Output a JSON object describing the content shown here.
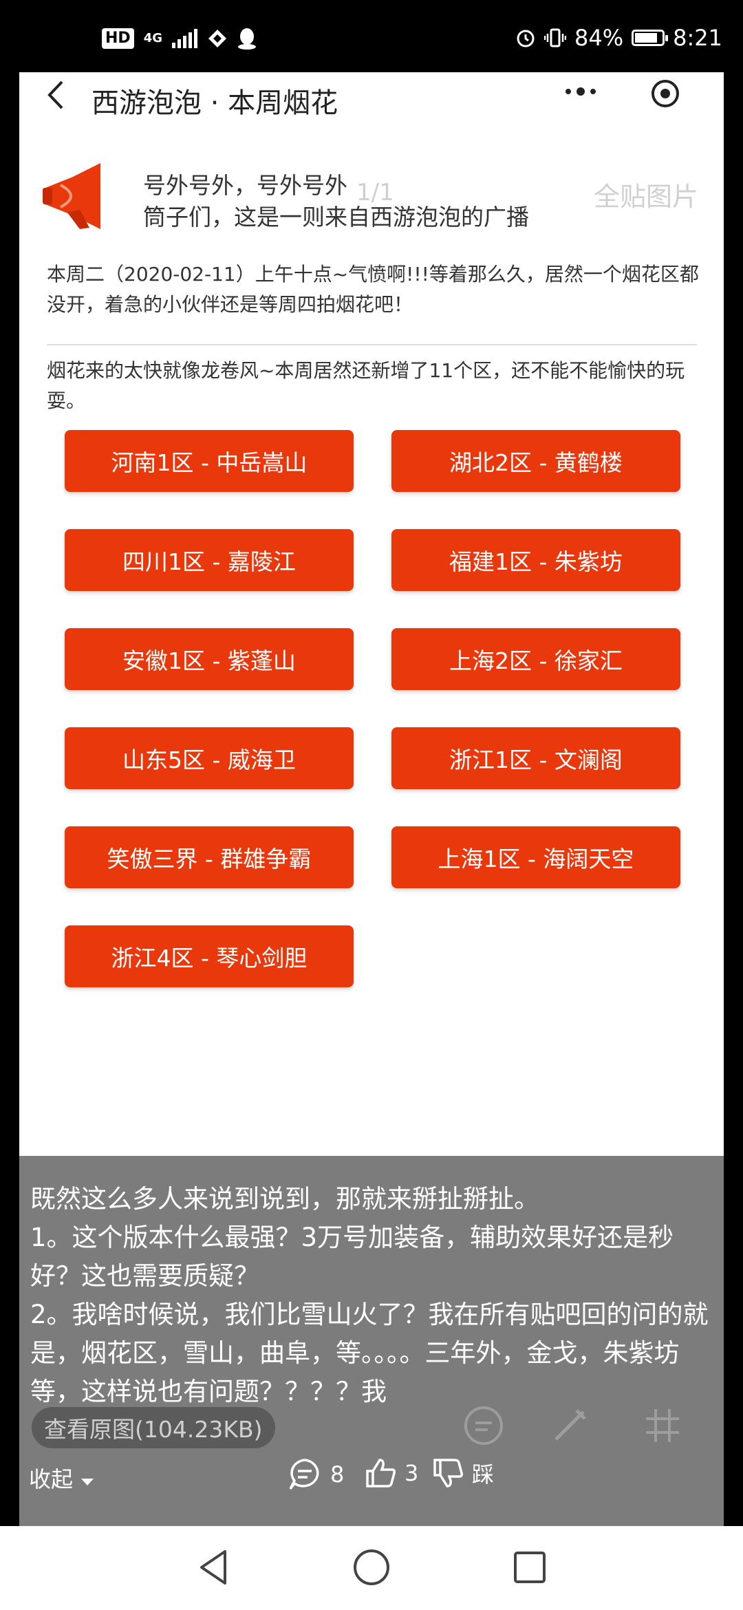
{
  "status_bar": {
    "hd": "HD",
    "network": "4G",
    "battery_percent": "84%",
    "battery_level": 0.84,
    "time": "8:21",
    "icons": [
      "hd-icon",
      "signal-icon",
      "vpn-icon",
      "qq-icon",
      "alarm-icon",
      "vibrate-icon",
      "battery-icon"
    ]
  },
  "mini_app": {
    "title": "西游泡泡 · 本周烟花",
    "announce_line1": "号外号外，号外号外",
    "announce_line2": "筒子们，这是一则来自西游泡泡的广播",
    "para1": "本周二（2020-02-11）上午十点~气愤啊!!!等着那么久，居然一个烟花区都没开，着急的小伙伴还是等周四拍烟花吧！",
    "para2": "烟花来的太快就像龙卷风~本周居然还新增了11个区，还不能不能愉快的玩耍。",
    "districts": [
      "河南1区 - 中岳嵩山",
      "湖北2区 - 黄鹤楼",
      "四川1区 - 嘉陵江",
      "福建1区 - 朱紫坊",
      "安徽1区 - 紫蓬山",
      "上海2区 - 徐家汇",
      "山东5区 - 威海卫",
      "浙江1区 - 文澜阁",
      "笑傲三界 - 群雄争霸",
      "上海1区 - 海阔天空",
      "浙江4区 - 琴心剑胆"
    ]
  },
  "viewer": {
    "counter": "1/1",
    "full_image": "全贴图片",
    "view_original": "查看原图(104.23KB)"
  },
  "comment": {
    "lines": [
      "既然这么多人来说到说到，那就来掰扯掰扯。",
      "1。这个版本什么最强？3万号加装备，辅助效果好还是秒好？这也需要质疑？",
      "2。我啥时候说，我们比雪山火了？我在所有贴吧回的问的就是，烟花区，雪山，曲阜，等。。。。三年外，金戈，朱紫坊等，这样说也有问题？？？？我"
    ],
    "collapse_label": "收起",
    "comment_count": "8",
    "like_count": "3",
    "dislike_label": "踩"
  },
  "colors": {
    "accent": "#e8380c",
    "overlay_bg": "#7c7c7c"
  }
}
